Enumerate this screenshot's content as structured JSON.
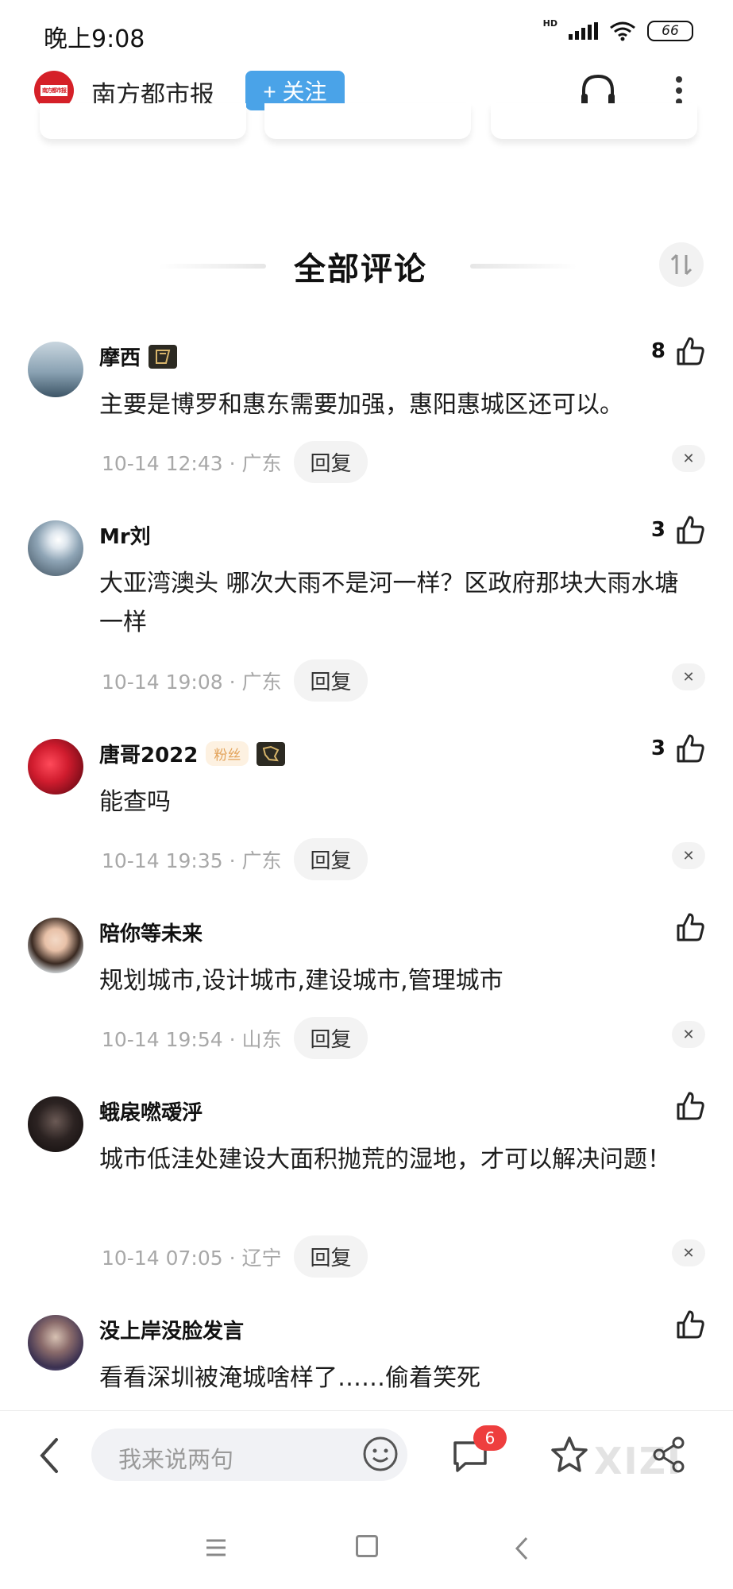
{
  "status_bar": {
    "time": "晚上9:08",
    "network": "HD",
    "battery": "66"
  },
  "header": {
    "source_name": "南方都市报",
    "follow_label": "+ 关注",
    "logo_text": "南方都市报"
  },
  "section": {
    "title": "全部评论"
  },
  "comments": [
    {
      "user": "摩西",
      "badge": true,
      "fan_tag": "",
      "likes": "8",
      "text": "主要是博罗和惠东需要加强，惠阳惠城区还可以。",
      "time": "10-14 12:43 · 广东",
      "reply": "回复"
    },
    {
      "user": "Mr刘",
      "badge": false,
      "fan_tag": "",
      "likes": "3",
      "text": "大亚湾澳头 哪次大雨不是河一样？区政府那块大雨水塘一样",
      "time": "10-14 19:08 · 广东",
      "reply": "回复"
    },
    {
      "user": "唐哥2022",
      "badge": true,
      "fan_tag": "粉丝",
      "likes": "3",
      "text": "能查吗",
      "time": "10-14 19:35 · 广东",
      "reply": "回复"
    },
    {
      "user": "陪你等未来",
      "badge": false,
      "fan_tag": "",
      "likes": "",
      "text": "规划城市,设计城市,建设城市,管理城市",
      "time": "10-14 19:54 · 山东",
      "reply": "回复"
    },
    {
      "user": "蛾扆嘫叆泘",
      "badge": false,
      "fan_tag": "",
      "likes": "",
      "text": "城市低洼处建设大面积抛荒的湿地，才可以解决问题！",
      "time": "10-14 07:05 · 辽宁",
      "reply": "回复"
    },
    {
      "user": "没上岸没脸发言",
      "badge": false,
      "fan_tag": "",
      "likes": "",
      "text": "看看深圳被淹城啥样了……偷着笑死",
      "time": "",
      "reply": ""
    }
  ],
  "bottom_bar": {
    "input_placeholder": "我来说两句",
    "comment_count": "6",
    "watermark": "XIZI"
  },
  "colors": {
    "accent": "#4aa3e8",
    "brand_red": "#d52028",
    "badge_red": "#ee3e3e"
  }
}
